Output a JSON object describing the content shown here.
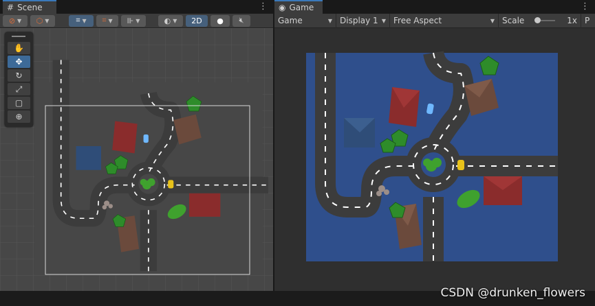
{
  "scene_tab": {
    "title": "Scene",
    "menu": "⋮"
  },
  "game_tab": {
    "title": "Game",
    "menu": "⋮"
  },
  "scene_toolbar": {
    "mode_2d_label": "2D"
  },
  "game_toolbar": {
    "game_label": "Game",
    "display_label": "Display 1",
    "aspect_label": "Free Aspect",
    "scale_label": "Scale",
    "scale_value": "1x",
    "extra_label": "P"
  },
  "tools": [
    {
      "name": "hand-tool",
      "glyph": "✋"
    },
    {
      "name": "move-tool",
      "glyph": "✥"
    },
    {
      "name": "rotate-tool",
      "glyph": "↻"
    },
    {
      "name": "scale-tool",
      "glyph": "⤢"
    },
    {
      "name": "rect-tool",
      "glyph": "▢"
    },
    {
      "name": "transform-tool",
      "glyph": "⊕"
    }
  ],
  "colors": {
    "background_blue": "#2f4f8c",
    "road": "#3c3c3c",
    "road_marking": "#ffffff",
    "grass": "#3fa12e",
    "red_roof": "#8a2c2c",
    "blue_roof": "#2f4d78",
    "brown_roof": "#6b4a3c",
    "car_yellow": "#e8c21a",
    "car_blue": "#6fb8ff"
  },
  "watermark": "CSDN @drunken_flowers"
}
